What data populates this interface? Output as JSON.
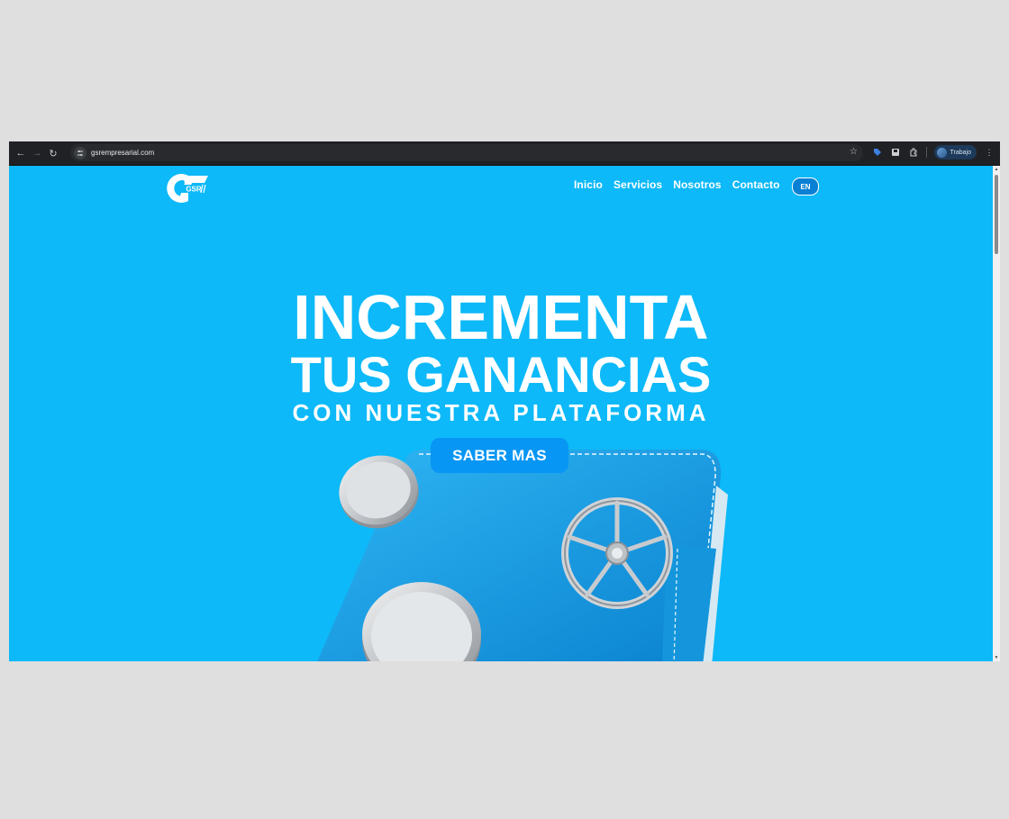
{
  "browser": {
    "url": "gsrempresarial.com",
    "profile_label": "Trabajo",
    "icons": {
      "back": "arrow-left-icon",
      "forward": "arrow-right-icon",
      "reload": "reload-icon",
      "site_info": "tune-icon",
      "bookmark": "star-icon",
      "menu": "more-vert-icon"
    }
  },
  "site": {
    "logo_text": "GSR",
    "nav": [
      "Inicio",
      "Servicios",
      "Nosotros",
      "Contacto"
    ],
    "lang_button": "EN",
    "hero": {
      "line1": "INCREMENTA",
      "line2": "TUS GANANCIAS",
      "line3": "CON NUESTRA PLATAFORMA",
      "cta": "SABER MAS"
    },
    "colors": {
      "background": "#0db9f8",
      "cta": "#0896f4",
      "wallet": "#1aa8ef"
    }
  }
}
